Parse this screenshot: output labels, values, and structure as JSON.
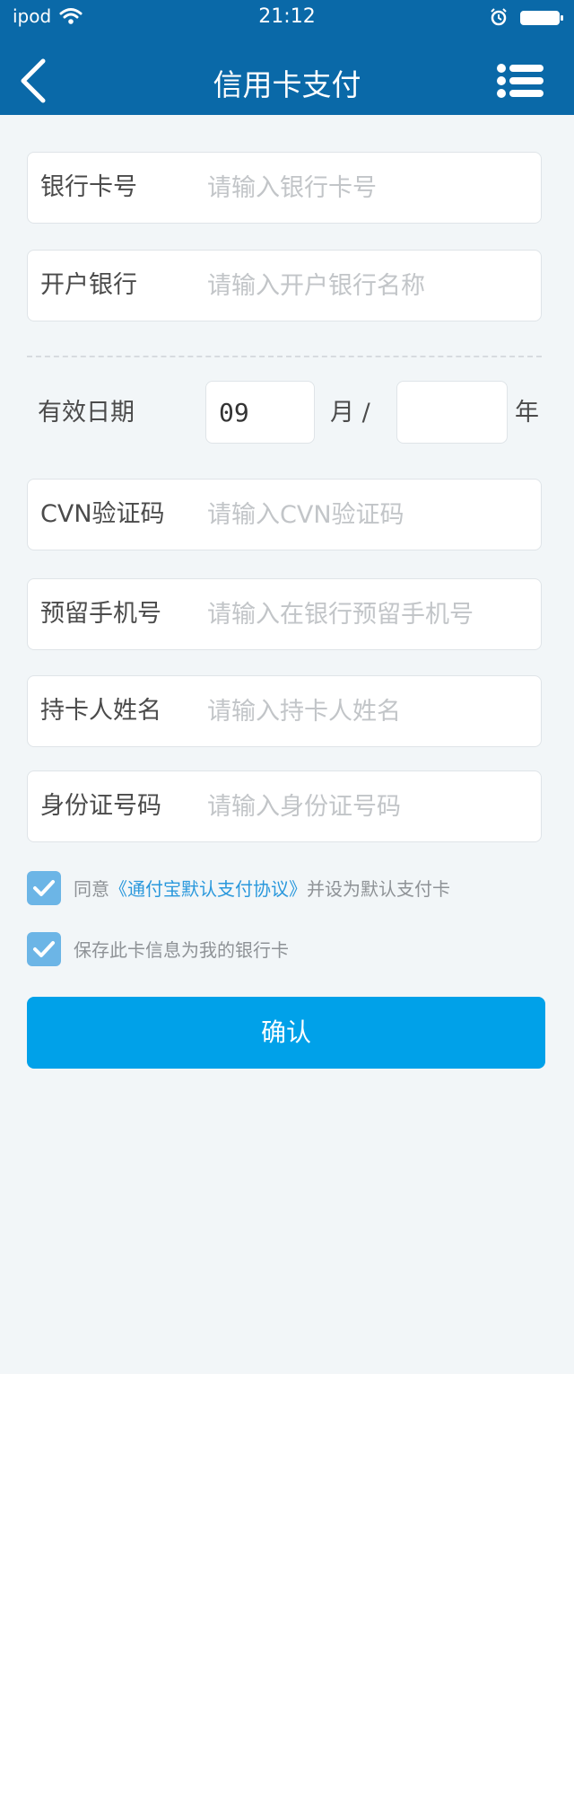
{
  "status_bar": {
    "carrier": "ipod",
    "time": "21:12"
  },
  "header": {
    "title": "信用卡支付"
  },
  "form": {
    "card_number": {
      "label": "银行卡号",
      "placeholder": "请输入银行卡号"
    },
    "bank": {
      "label": "开户银行",
      "placeholder": "请输入开户银行名称"
    },
    "expiry": {
      "label": "有效日期",
      "month_value": "09",
      "month_unit": "月 /",
      "year_value": "",
      "year_unit": "年"
    },
    "cvn": {
      "label": "CVN验证码",
      "placeholder": "请输入CVN验证码"
    },
    "phone": {
      "label": "预留手机号",
      "placeholder": "请输入在银行预留手机号"
    },
    "holder": {
      "label": "持卡人姓名",
      "placeholder": "请输入持卡人姓名"
    },
    "id_number": {
      "label": "身份证号码",
      "placeholder": "请输入身份证号码"
    }
  },
  "agreements": {
    "agree_prefix": "同意",
    "agree_link": "《通付宝默认支付协议》",
    "agree_suffix": "并设为默认支付卡",
    "agree_checked": true,
    "save_text": "保存此卡信息为我的银行卡",
    "save_checked": true
  },
  "confirm_label": "确认",
  "colors": {
    "header_bg": "#0a69a8",
    "page_bg": "#f2f6f8",
    "primary_button": "#00a1e9",
    "checkbox": "#6cb5e6",
    "link": "#2a98dc"
  },
  "icons": [
    "wifi-icon",
    "alarm-clock-icon",
    "battery-icon",
    "back-arrow-icon",
    "menu-list-icon",
    "checkmark-icon"
  ]
}
